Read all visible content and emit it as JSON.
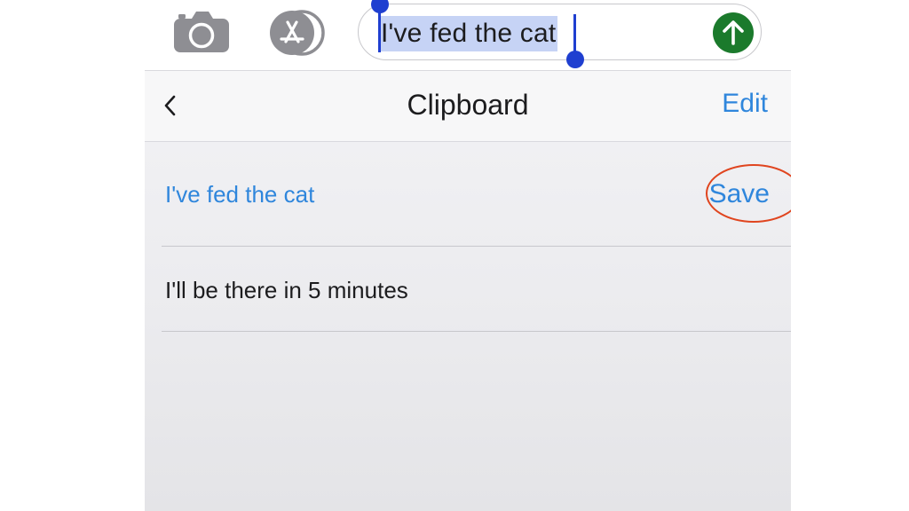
{
  "compose": {
    "camera_icon": "camera-icon",
    "appstore_icon": "app-store-icon",
    "message_text": "I've fed the cat",
    "send_icon": "arrow-up-icon",
    "send_color": "#1b7a2c",
    "selection_color": "#c6d3f5",
    "handle_color": "#1f3fd0"
  },
  "clipboard": {
    "back_icon": "chevron-left-icon",
    "title": "Clipboard",
    "edit_label": "Edit",
    "items": [
      {
        "text": "I've fed the cat",
        "action_label": "Save",
        "highlighted": true
      },
      {
        "text": "I'll be there in 5 minutes"
      }
    ],
    "accent_color": "#2f86dc",
    "annotation_color": "#e0451f"
  }
}
